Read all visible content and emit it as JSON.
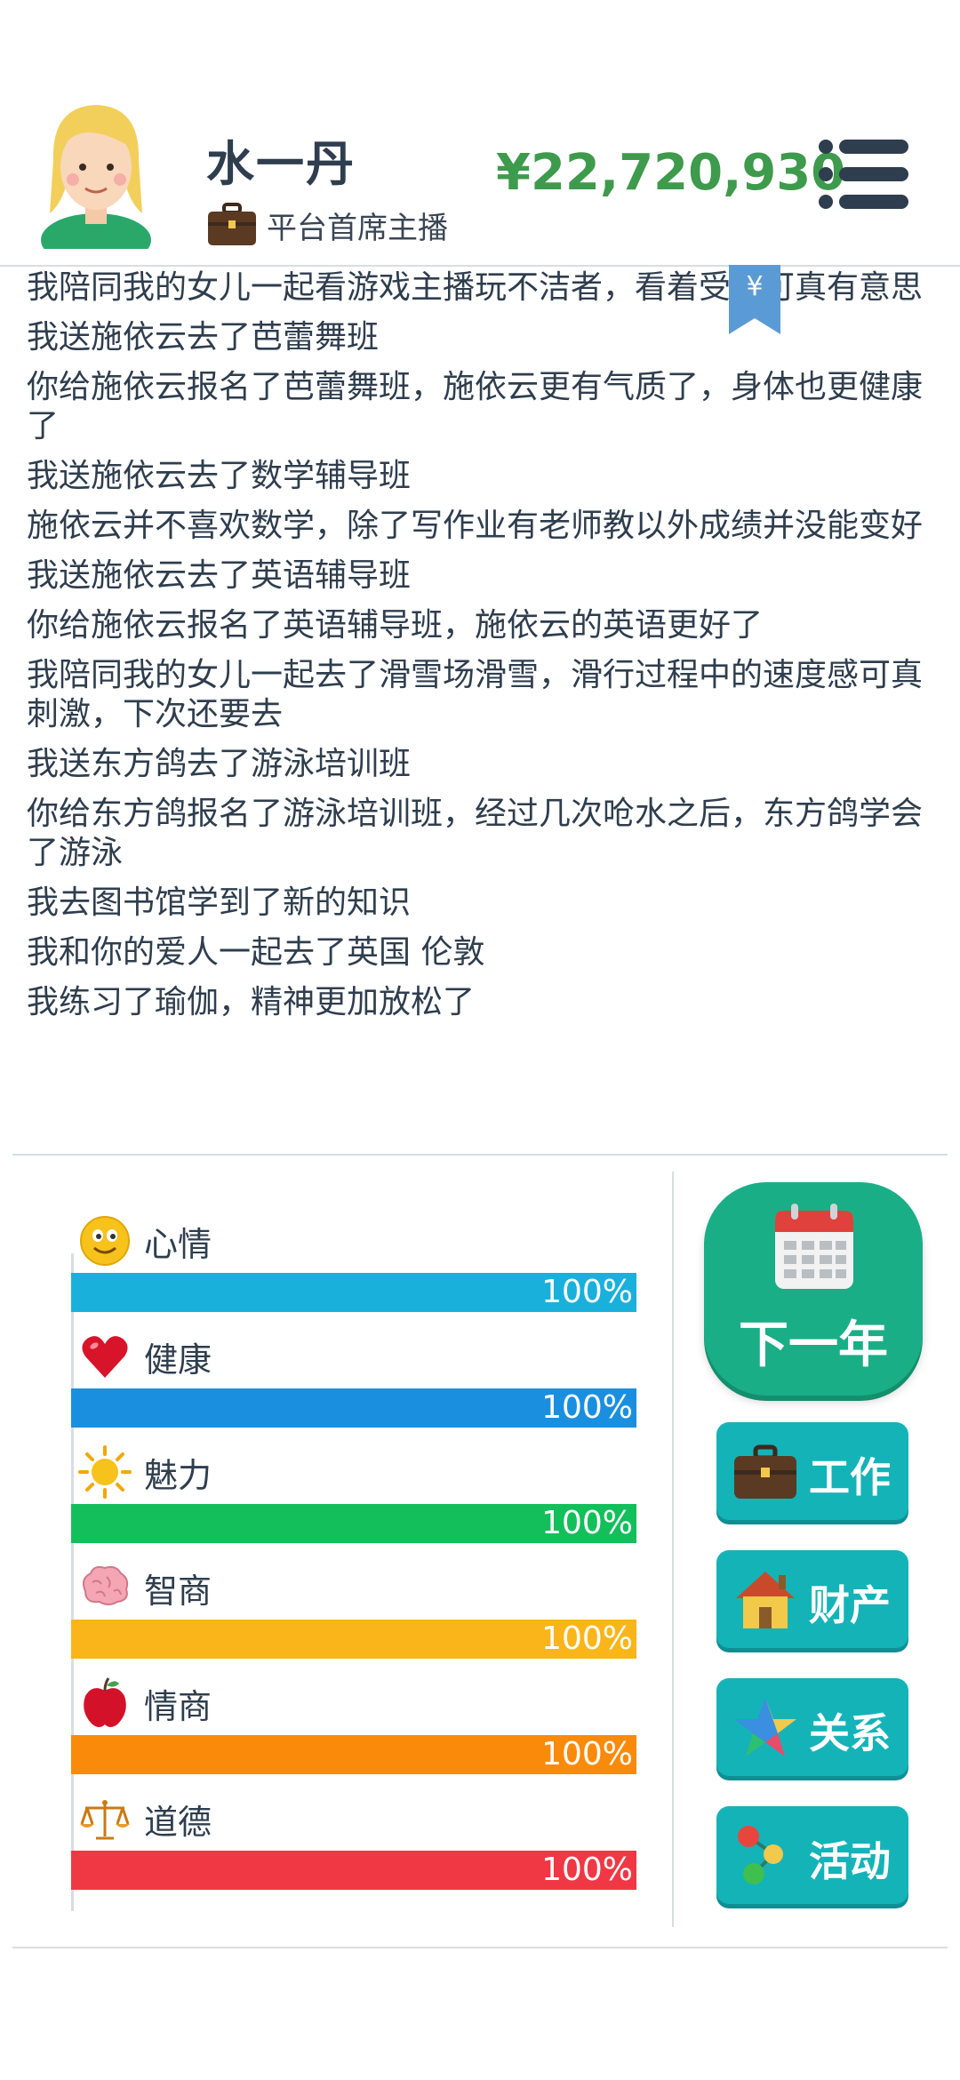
{
  "header": {
    "player_name": "水一丹",
    "job_title": "平台首席主播",
    "money": "¥22,720,930",
    "bookmark_symbol": "¥"
  },
  "log": [
    "我陪同我的女儿一起看游戏主播玩不洁者，看着受苦可真有意思",
    "我送施依云去了芭蕾舞班",
    "你给施依云报名了芭蕾舞班，施依云更有气质了，身体也更健康了",
    "我送施依云去了数学辅导班",
    "施依云并不喜欢数学，除了写作业有老师教以外成绩并没能变好",
    "我送施依云去了英语辅导班",
    "你给施依云报名了英语辅导班，施依云的英语更好了",
    "我陪同我的女儿一起去了滑雪场滑雪，滑行过程中的速度感可真刺激，下次还要去",
    "我送东方鸽去了游泳培训班",
    "你给东方鸽报名了游泳培训班，经过几次呛水之后，东方鸽学会了游泳",
    "我去图书馆学到了新的知识",
    "我和你的爱人一起去了英国 伦敦",
    "我练习了瑜伽，精神更加放松了"
  ],
  "stats": [
    {
      "label": "心情",
      "value_text": "100%",
      "value": 1.0,
      "color": "#1ab0dc",
      "icon": "smiley-icon"
    },
    {
      "label": "健康",
      "value_text": "100%",
      "value": 1.0,
      "color": "#1a8fe0",
      "icon": "heart-icon"
    },
    {
      "label": "魅力",
      "value_text": "100%",
      "value": 1.0,
      "color": "#13bf5a",
      "icon": "sun-icon"
    },
    {
      "label": "智商",
      "value_text": "100%",
      "value": 1.0,
      "color": "#f9b51a",
      "icon": "brain-icon"
    },
    {
      "label": "情商",
      "value_text": "100%",
      "value": 1.0,
      "color": "#fa8a0a",
      "icon": "apple-icon"
    },
    {
      "label": "道德",
      "value_text": "100%",
      "value": 1.0,
      "color": "#ef3844",
      "icon": "scales-icon"
    }
  ],
  "actions": {
    "next_year": "下一年",
    "work": "工作",
    "property": "财产",
    "relations": "关系",
    "activities": "活动"
  }
}
